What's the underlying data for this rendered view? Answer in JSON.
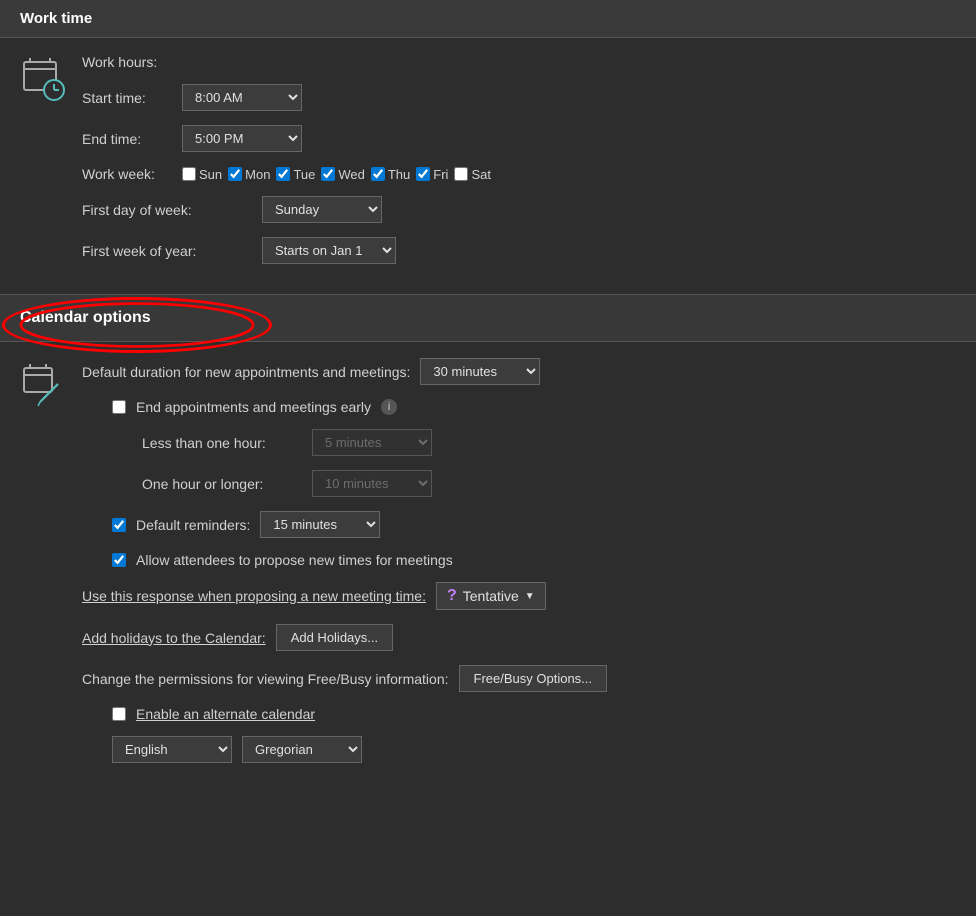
{
  "worktime": {
    "section_title": "Work time",
    "work_hours_label": "Work hours:",
    "start_time_label": "Start time:",
    "end_time_value": "8:00 AM",
    "end_time_label": "End time:",
    "end_time_value2": "5:00 PM",
    "work_week_label": "Work week:",
    "days": [
      {
        "name": "Sun",
        "checked": false
      },
      {
        "name": "Mon",
        "checked": true
      },
      {
        "name": "Tue",
        "checked": true
      },
      {
        "name": "Wed",
        "checked": true
      },
      {
        "name": "Thu",
        "checked": true
      },
      {
        "name": "Fri",
        "checked": true
      },
      {
        "name": "Sat",
        "checked": false
      }
    ],
    "first_day_label": "First day of week:",
    "first_day_value": "Sunday",
    "first_week_label": "First week of year:",
    "first_week_value": "Starts on Jan 1"
  },
  "calendar_options": {
    "section_title": "Calendar options",
    "default_duration_label": "Default duration for new appointments and meetings:",
    "default_duration_value": "30 minutes",
    "end_early_label": "End appointments and meetings early",
    "end_early_checked": false,
    "less_hour_label": "Less than one hour:",
    "less_hour_value": "5 minutes",
    "one_hour_label": "One hour or longer:",
    "one_hour_value": "10 minutes",
    "default_reminders_label": "Default reminders:",
    "default_reminders_checked": true,
    "default_reminders_value": "15 minutes",
    "allow_attendees_label": "Allow attendees to propose new times for meetings",
    "allow_attendees_checked": true,
    "use_response_label": "Use this response when proposing a new meeting time:",
    "tentative_label": "Tentative",
    "add_holidays_label": "Add holidays to the Calendar:",
    "add_holidays_button": "Add Holidays...",
    "change_permissions_label": "Change the permissions for viewing Free/Busy information:",
    "free_busy_button": "Free/Busy Options...",
    "alternate_calendar_label": "Enable an alternate calendar",
    "alternate_calendar_checked": false,
    "language_value": "English",
    "calendar_type_value": "Gregorian"
  }
}
